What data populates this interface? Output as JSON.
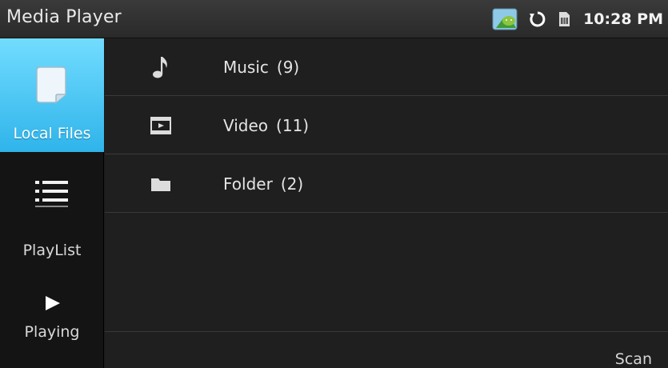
{
  "statusbar": {
    "title": "Media Player",
    "time": "10:28 PM",
    "icons": [
      "android-notification-icon",
      "sync-icon",
      "sim-card-icon"
    ]
  },
  "sidebar": {
    "items": [
      {
        "label": "Local Files",
        "icon": "file-icon",
        "active": true
      },
      {
        "label": "PlayList",
        "icon": "list-icon",
        "active": false
      },
      {
        "label": "Playing",
        "icon": "play-icon",
        "active": false
      }
    ]
  },
  "main": {
    "rows": [
      {
        "label": "Music",
        "count": "(9)",
        "icon": "music-note-icon"
      },
      {
        "label": "Video",
        "count": "(11)",
        "icon": "video-icon"
      },
      {
        "label": "Folder",
        "count": "(2)",
        "icon": "folder-icon"
      }
    ],
    "scan_label": "Scan"
  },
  "colors": {
    "active_tab_top": "#72dcff",
    "active_tab_bottom": "#2fb4ea",
    "background": "#1f1f1f"
  }
}
